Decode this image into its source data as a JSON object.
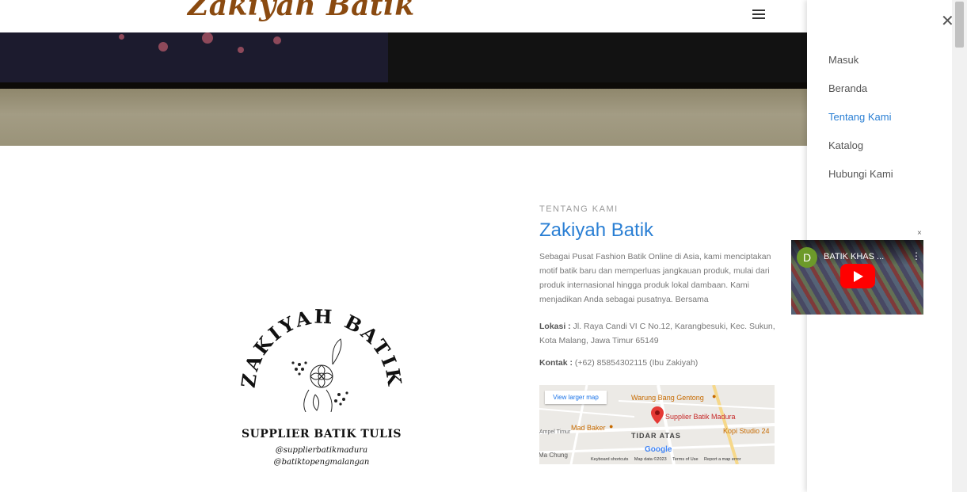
{
  "header": {
    "brand": "Zakiyah Batik"
  },
  "about": {
    "eyebrow": "TENTANG KAMI",
    "title": "Zakiyah Batik",
    "paragraph": "Sebagai Pusat Fashion Batik Online di Asia, kami menciptakan motif batik baru dan memperluas jangkauan produk, mulai dari produk internasional hingga produk lokal dambaan. Kami menjadikan Anda sebagai pusatnya. Bersama",
    "lokasi_label": "Lokasi :",
    "lokasi_value": "Jl. Raya Candi VI C No.12, Karangbesuki, Kec. Sukun, Kota Malang, Jawa Timur 65149",
    "kontak_label": "Kontak :",
    "kontak_value": "(+62) 85854302115 (Ibu Zakiyah)"
  },
  "logo": {
    "arc_text": "ZAKIYAH BATIK",
    "tagline": "SUPPLIER BATIK TULIS",
    "handle1": "@supplierbatikmadura",
    "handle2": "@batiktopengmalangan"
  },
  "map": {
    "view_larger": "View larger map",
    "place": "Supplier Batik Madura",
    "poi1": "Warung Bang Gentong",
    "poi2": "Mad Baker",
    "poi3": "Kopi Studio 24",
    "area": "TIDAR ATAS",
    "street": "Ampel Timur",
    "poi4": "Ma Chung",
    "google": "Google",
    "footer": [
      "Keyboard shortcuts",
      "Map data ©2023",
      "Terms of Use",
      "Report a map error"
    ]
  },
  "menu": {
    "items": [
      {
        "label": "Masuk",
        "active": false
      },
      {
        "label": "Beranda",
        "active": false
      },
      {
        "label": "Tentang Kami",
        "active": true
      },
      {
        "label": "Katalog",
        "active": false
      },
      {
        "label": "Hubungi Kami",
        "active": false
      }
    ],
    "close_icon": "close-icon"
  },
  "video": {
    "avatar_letter": "D",
    "title": "BATIK KHAS ...",
    "close": "×"
  },
  "colors": {
    "brand": "#8a4a10",
    "accent": "#2a7fd4",
    "pin": "#e53935"
  }
}
